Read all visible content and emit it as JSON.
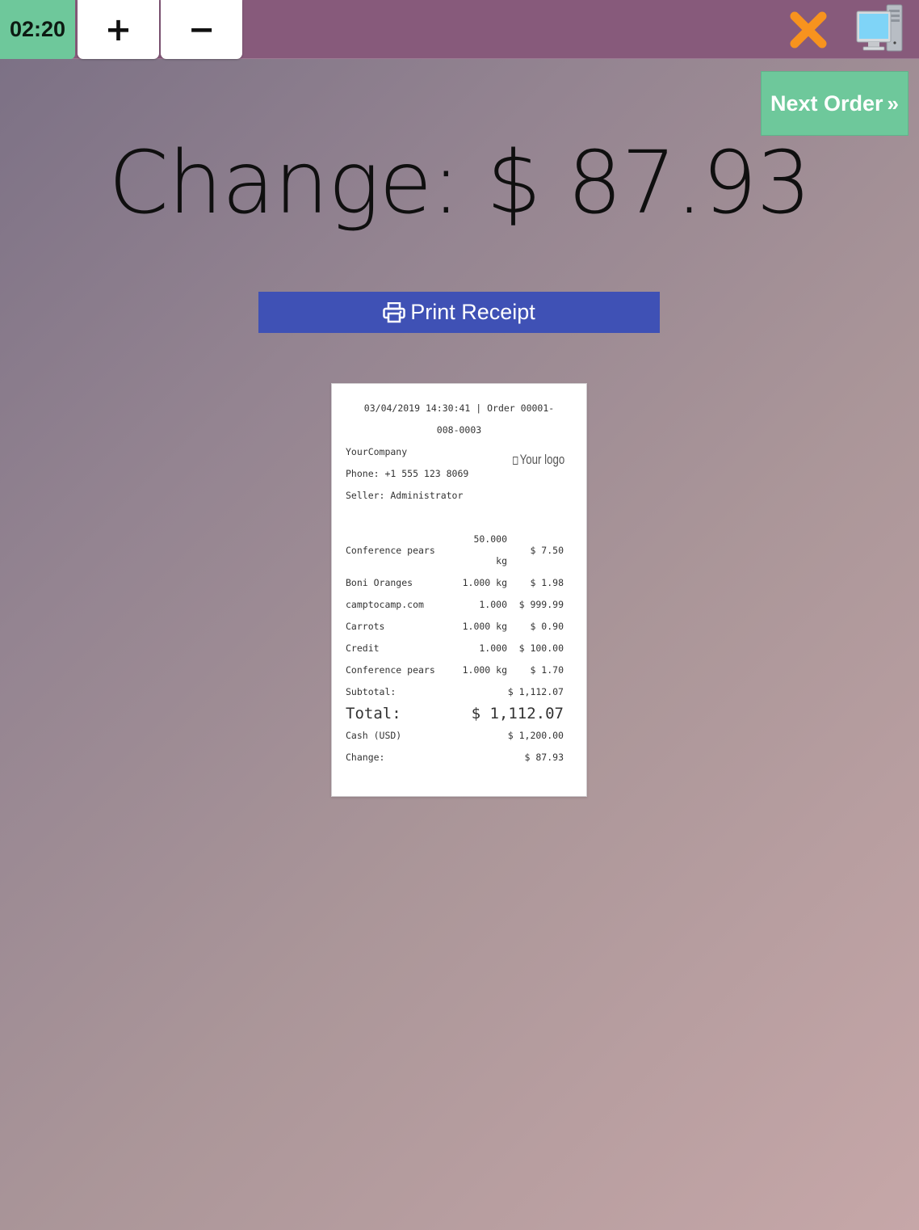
{
  "header": {
    "timer": "02:20",
    "plus_label": "+",
    "minus_label": "−",
    "icons": {
      "close": "close-icon",
      "pos": "computer-icon"
    }
  },
  "next_order": {
    "label": "Next Order",
    "chevron": "»"
  },
  "change_display": "Change: $ 87.93",
  "print_receipt": {
    "label": "Print Receipt",
    "icon": "printer-icon"
  },
  "receipt": {
    "header_line": "03/04/2019 14:30:41 | Order 00001-008-0003",
    "company": "YourCompany",
    "phone": "Phone: +1 555 123 8069",
    "seller": "Seller: Administrator",
    "logo": "Your logo",
    "lines": [
      {
        "product": "Conference pears",
        "qty": "50.000 kg",
        "price": "$ 7.50"
      },
      {
        "product": "Boni Oranges",
        "qty": "1.000 kg",
        "price": "$ 1.98"
      },
      {
        "product": "camptocamp.com",
        "qty": "1.000",
        "price": "$ 999.99"
      },
      {
        "product": "Carrots",
        "qty": "1.000 kg",
        "price": "$ 0.90"
      },
      {
        "product": "Credit",
        "qty": "1.000",
        "price": "$ 100.00"
      },
      {
        "product": "Conference pears",
        "qty": "1.000 kg",
        "price": "$ 1.70"
      }
    ],
    "subtotal_label": "Subtotal:",
    "subtotal_value": "$ 1,112.07",
    "total_label": "Total:",
    "total_value": "$ 1,112.07",
    "cash_label": "Cash (USD)",
    "cash_value": "$ 1,200.00",
    "change_label": "Change:",
    "change_value": "$ 87.93"
  },
  "colors": {
    "topbar": "#875a7b",
    "accent_green": "#6ec89b",
    "print_blue": "#3f51b5",
    "close_orange": "#f7931e"
  }
}
